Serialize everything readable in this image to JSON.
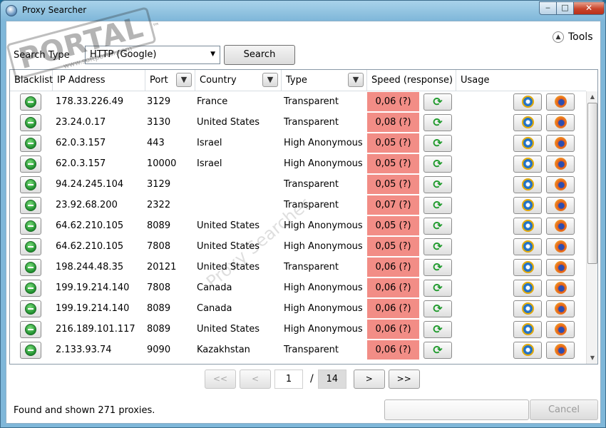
{
  "window": {
    "title": "Proxy Searcher",
    "min_label": "‒",
    "max_label": "□",
    "close_label": "✕"
  },
  "tools": {
    "label": "Tools",
    "icon": "chevron-up-icon"
  },
  "search": {
    "type_label": "Search Type",
    "type_value": "HTTP (Google)",
    "button_label": "Search"
  },
  "table": {
    "headers": {
      "blacklist": "Blacklist",
      "ip": "IP Address",
      "port": "Port",
      "country": "Country",
      "type": "Type",
      "speed": "Speed (response)",
      "usage": "Usage"
    },
    "rows": [
      {
        "ip": "178.33.226.49",
        "port": "3129",
        "country": "France",
        "type": "Transparent",
        "speed": "0,06 (?)"
      },
      {
        "ip": "23.24.0.17",
        "port": "3130",
        "country": "United States",
        "type": "Transparent",
        "speed": "0,08 (?)"
      },
      {
        "ip": "62.0.3.157",
        "port": "443",
        "country": "Israel",
        "type": "High Anonymous",
        "speed": "0,05 (?)"
      },
      {
        "ip": "62.0.3.157",
        "port": "10000",
        "country": "Israel",
        "type": "High Anonymous",
        "speed": "0,05 (?)"
      },
      {
        "ip": "94.24.245.104",
        "port": "3129",
        "country": "",
        "type": "Transparent",
        "speed": "0,05 (?)"
      },
      {
        "ip": "23.92.68.200",
        "port": "2322",
        "country": "",
        "type": "Transparent",
        "speed": "0,07 (?)"
      },
      {
        "ip": "64.62.210.105",
        "port": "8089",
        "country": "United States",
        "type": "High Anonymous",
        "speed": "0,05 (?)"
      },
      {
        "ip": "64.62.210.105",
        "port": "7808",
        "country": "United States",
        "type": "High Anonymous",
        "speed": "0,05 (?)"
      },
      {
        "ip": "198.244.48.35",
        "port": "20121",
        "country": "United States",
        "type": "Transparent",
        "speed": "0,06 (?)"
      },
      {
        "ip": "199.19.214.140",
        "port": "7808",
        "country": "Canada",
        "type": "High Anonymous",
        "speed": "0,06 (?)"
      },
      {
        "ip": "199.19.214.140",
        "port": "8089",
        "country": "Canada",
        "type": "High Anonymous",
        "speed": "0,06 (?)"
      },
      {
        "ip": "216.189.101.117",
        "port": "8089",
        "country": "United States",
        "type": "High Anonymous",
        "speed": "0,06 (?)"
      },
      {
        "ip": "2.133.93.74",
        "port": "9090",
        "country": "Kazakhstan",
        "type": "Transparent",
        "speed": "0,06 (?)"
      }
    ]
  },
  "pager": {
    "first": "<<",
    "prev": "<",
    "current": "1",
    "separator": "/",
    "total": "14",
    "next": ">",
    "last": ">>"
  },
  "status": {
    "text": "Found and shown 271 proxies.",
    "cancel_label": "Cancel"
  },
  "watermarks": {
    "diagonal": "Proxy Searcher",
    "stamp": "PORTAL",
    "stamp_mark": "™",
    "stamp_url": "www.softportal.com"
  },
  "colors": {
    "speed_bg": "#f28d86",
    "accent": "#1d6e9a"
  }
}
